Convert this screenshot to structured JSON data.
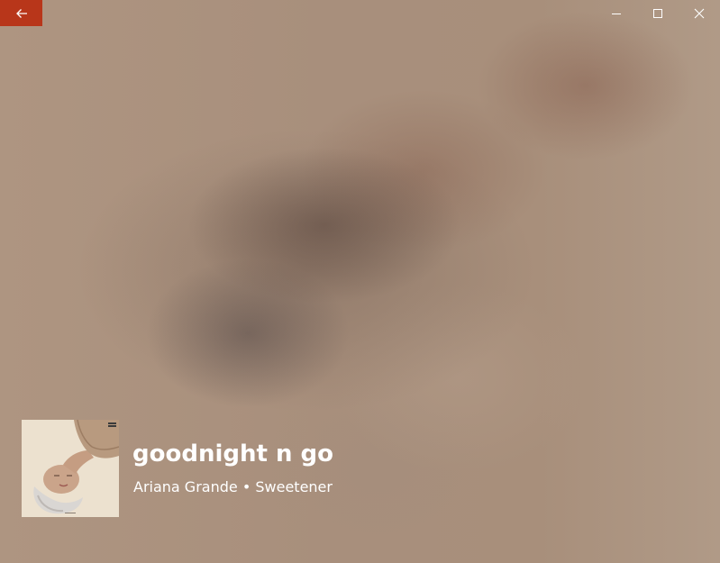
{
  "titlebar": {
    "back_icon": "arrow-left-icon",
    "accent_color": "#b8361a",
    "minimize_icon": "minimize-icon",
    "maximize_icon": "maximize-icon",
    "close_icon": "close-icon"
  },
  "now_playing": {
    "title": "goodnight n go",
    "artist": "Ariana Grande",
    "separator": "•",
    "album": "Sweetener",
    "text_color": "#ffffff"
  }
}
